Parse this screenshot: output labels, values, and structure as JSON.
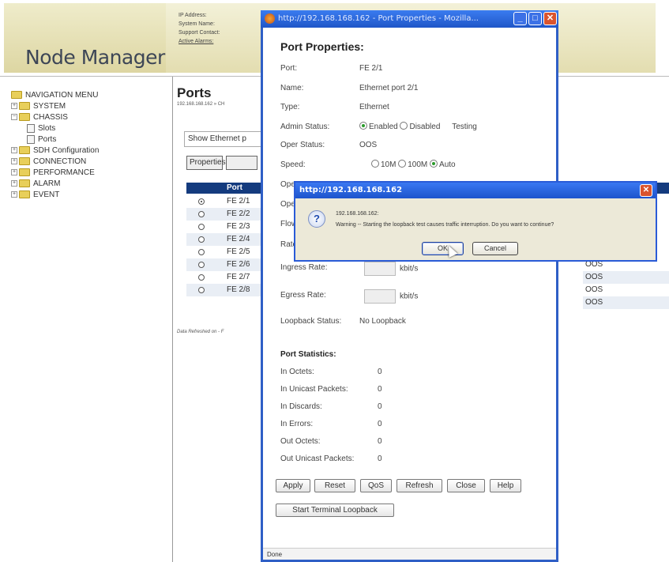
{
  "app": {
    "logo": "Node Manager",
    "info_lines": [
      "IP Address:",
      "System Name:",
      "Support Contact:",
      "Active Alarms:"
    ]
  },
  "nav": {
    "root": "NAVIGATION MENU",
    "items": [
      {
        "label": "SYSTEM",
        "level": 1,
        "type": "folder",
        "expander": "+"
      },
      {
        "label": "CHASSIS",
        "level": 1,
        "type": "folder",
        "expander": "−"
      },
      {
        "label": "Slots",
        "level": 2,
        "type": "page"
      },
      {
        "label": "Ports",
        "level": 2,
        "type": "page"
      },
      {
        "label": "SDH Configuration",
        "level": 1,
        "type": "folder",
        "expander": "+"
      },
      {
        "label": "CONNECTION",
        "level": 1,
        "type": "folder",
        "expander": "+"
      },
      {
        "label": "PERFORMANCE",
        "level": 1,
        "type": "folder",
        "expander": "+"
      },
      {
        "label": "ALARM",
        "level": 1,
        "type": "folder",
        "expander": "+"
      },
      {
        "label": "EVENT",
        "level": 1,
        "type": "folder",
        "expander": "+"
      }
    ]
  },
  "ports_page": {
    "title": "Ports",
    "subtitle": "192.168.168.162 » CH",
    "show_select": "Show Ethernet p",
    "properties_btn": "Properties",
    "col_port": "Port",
    "rows": [
      {
        "port": "FE 2/1",
        "selected": true
      },
      {
        "port": "FE 2/2",
        "selected": false
      },
      {
        "port": "FE 2/3",
        "selected": false
      },
      {
        "port": "FE 2/4",
        "selected": false
      },
      {
        "port": "FE 2/5",
        "selected": false
      },
      {
        "port": "FE 2/6",
        "selected": false
      },
      {
        "port": "FE 2/7",
        "selected": false
      },
      {
        "port": "FE 2/8",
        "selected": false
      }
    ],
    "right_status": [
      "OOS",
      "OOS",
      "OOS",
      "OOS"
    ],
    "refreshed": "Data Refreshed on - F"
  },
  "popup": {
    "window_title": "http://192.168.168.162 - Port Properties - Mozilla...",
    "heading": "Port Properties:",
    "fields": {
      "port_label": "Port:",
      "port_value": "FE 2/1",
      "name_label": "Name:",
      "name_value": "Ethernet port 2/1",
      "type_label": "Type:",
      "type_value": "Ethernet",
      "admin_label": "Admin Status:",
      "admin_enabled": "Enabled",
      "admin_disabled": "Disabled",
      "admin_testing": "Testing",
      "oper_label": "Oper Status:",
      "oper_value": "OOS",
      "speed_label": "Speed:",
      "speed_10": "10M",
      "speed_100": "100M",
      "speed_auto": "Auto",
      "op1_label": "Ope",
      "op2_label": "Ope",
      "flow_label": "Flow",
      "rate_label": "Rate",
      "ingress_label": "Ingress Rate:",
      "ingress_unit": "kbit/s",
      "egress_label": "Egress Rate:",
      "egress_unit": "kbit/s",
      "loopback_label": "Loopback Status:",
      "loopback_value": "No Loopback"
    },
    "stats_heading": "Port Statistics:",
    "stats": [
      {
        "label": "In Octets:",
        "value": "0"
      },
      {
        "label": "In Unicast Packets:",
        "value": "0"
      },
      {
        "label": "In Discards:",
        "value": "0"
      },
      {
        "label": "In Errors:",
        "value": "0"
      },
      {
        "label": "Out Octets:",
        "value": "0"
      },
      {
        "label": "Out Unicast Packets:",
        "value": "0"
      }
    ],
    "buttons": {
      "apply": "Apply",
      "reset": "Reset",
      "qos": "QoS",
      "refresh": "Refresh",
      "close": "Close",
      "help": "Help",
      "loopback": "Start Terminal Loopback"
    },
    "status": "Done"
  },
  "alert": {
    "title": "http://192.168.168.162",
    "host": "192.168.168.162:",
    "message": "Warning -- Starting the loopback test causes traffic interruption. Do you want to continue?",
    "ok": "OK",
    "cancel": "Cancel"
  },
  "colors": {
    "titlebar": "#1f56c8",
    "table_header": "#143b7e",
    "logo_band": "#e6e0b5"
  }
}
